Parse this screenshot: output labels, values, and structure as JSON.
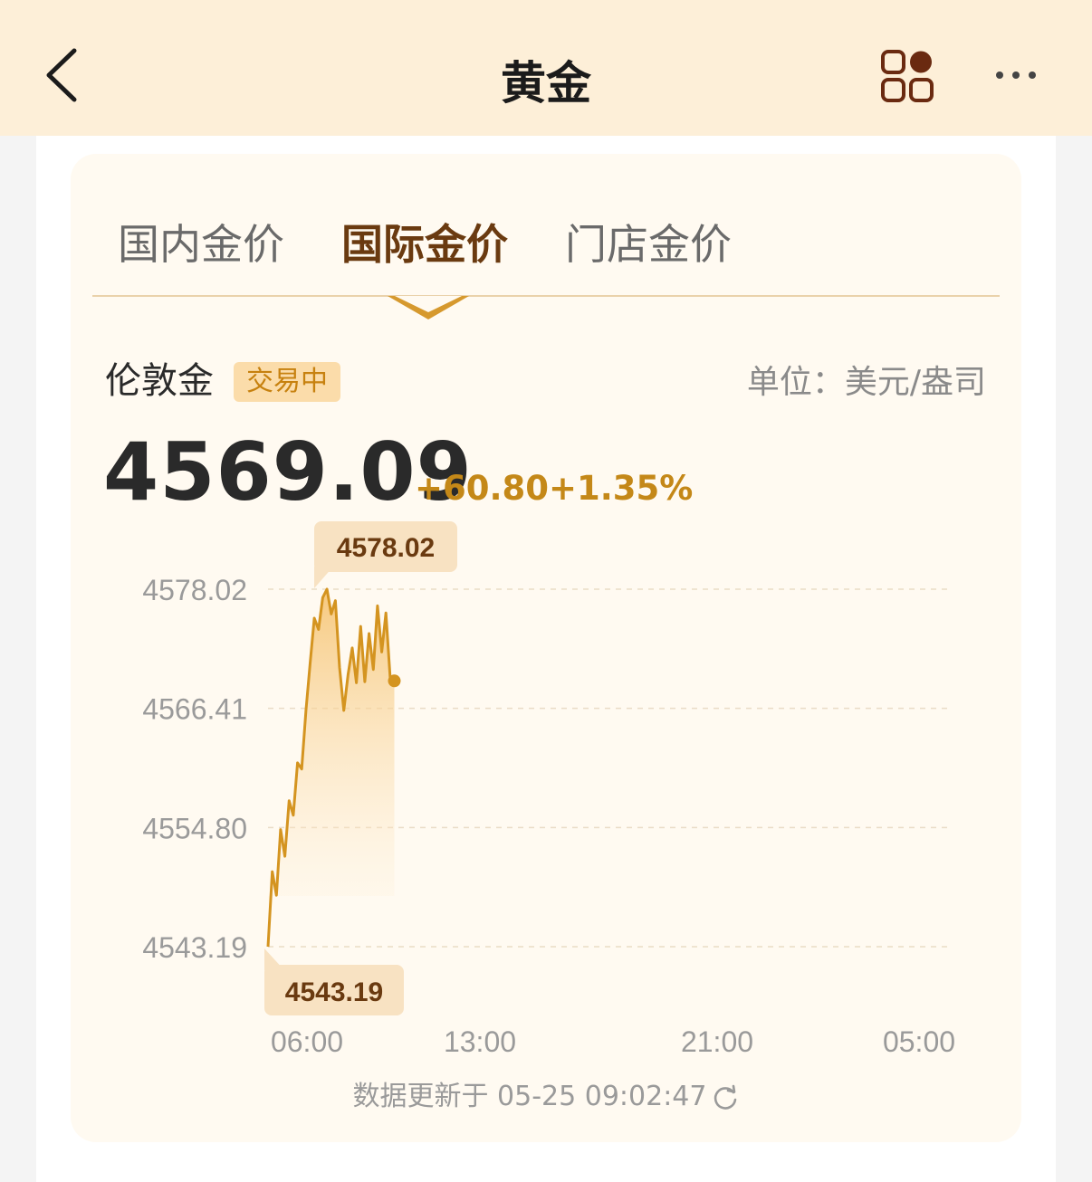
{
  "header": {
    "title": "黄金",
    "back_icon": "chevron-left-icon",
    "apps_icon": "apps-grid-icon",
    "more_icon": "more-dots-icon"
  },
  "tabs": [
    {
      "label": "国内金价",
      "active": false
    },
    {
      "label": "国际金价",
      "active": true
    },
    {
      "label": "门店金价",
      "active": false
    }
  ],
  "quote": {
    "name": "伦敦金",
    "status": "交易中",
    "unit": "单位：美元/盎司",
    "price": "4569.09",
    "change": "+60.80",
    "change_pct": "+1.35%"
  },
  "colors": {
    "accent": "#c48818",
    "header_bg": "#fdefd8",
    "card_bg": "#fffaf1",
    "active_tab": "#6a3a10",
    "badge_bg": "#fbdcaa",
    "tooltip_bg": "#f8e2c2"
  },
  "chart_data": {
    "type": "area",
    "ylim": [
      4543.19,
      4578.02
    ],
    "y_ticks": [
      "4578.02",
      "4566.41",
      "4554.80",
      "4543.19"
    ],
    "x_ticks": [
      "06:00",
      "13:00",
      "21:00",
      "05:00"
    ],
    "max_label": "4578.02",
    "min_label": "4543.19",
    "series": [
      {
        "time": [
          "04:00",
          "04:10",
          "04:20",
          "04:30",
          "04:40",
          "04:50",
          "05:00",
          "05:10",
          "05:20",
          "05:30",
          "05:40",
          "05:50",
          "06:00",
          "06:10",
          "06:20",
          "06:30",
          "06:40",
          "06:50",
          "07:00",
          "07:10",
          "07:20",
          "07:30",
          "07:40",
          "07:50",
          "08:00",
          "08:10",
          "08:20",
          "08:30",
          "08:40",
          "08:50",
          "09:00"
        ],
        "values": [
          4543.19,
          4550.5,
          4548.2,
          4554.6,
          4552.0,
          4557.4,
          4556.0,
          4561.1,
          4560.5,
          4566.2,
          4570.8,
          4575.2,
          4574.1,
          4577.2,
          4578.02,
          4575.6,
          4576.9,
          4570.4,
          4566.2,
          4569.7,
          4572.3,
          4568.9,
          4574.4,
          4569.0,
          4573.7,
          4570.2,
          4576.4,
          4571.9,
          4575.7,
          4569.4,
          4569.09
        ]
      }
    ],
    "grid": true
  },
  "footer": {
    "update_text": "数据更新于 05-25 09:02:47",
    "refresh_icon": "refresh-icon"
  }
}
